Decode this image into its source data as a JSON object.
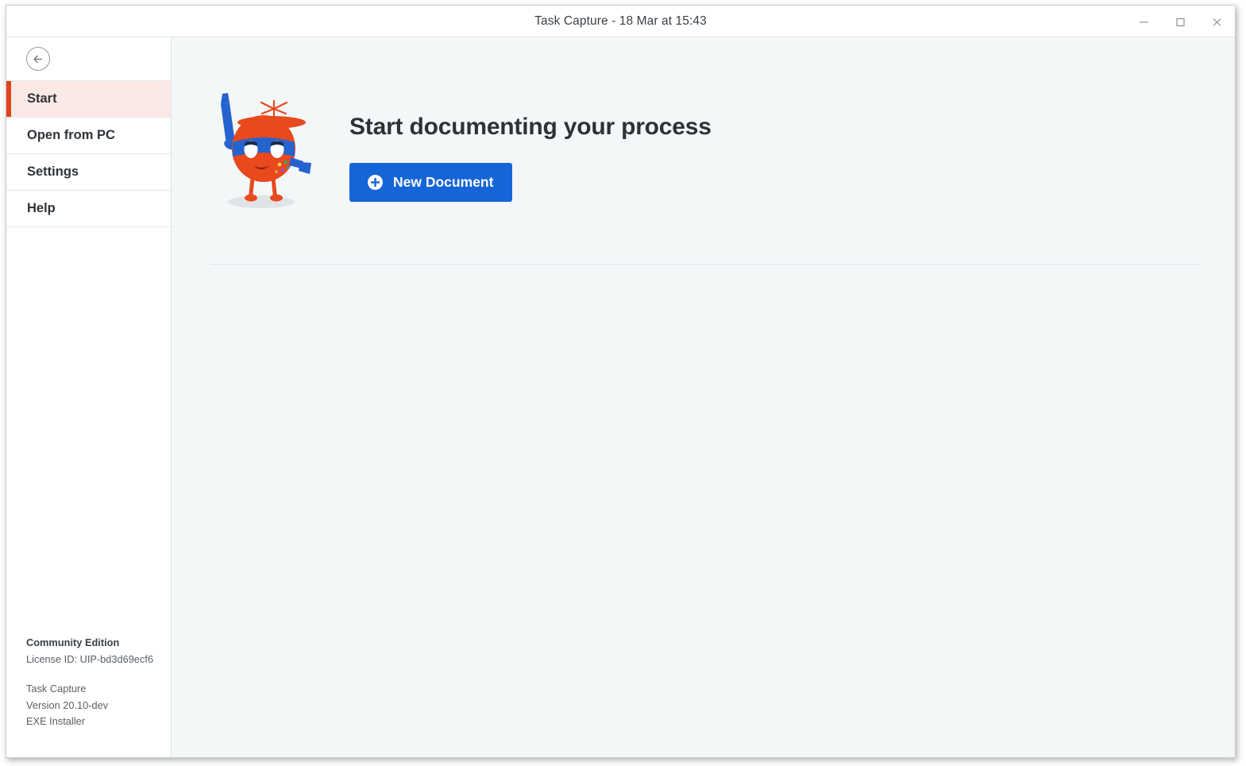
{
  "window": {
    "title": "Task Capture - 18 Mar at 15:43",
    "controls": {
      "minimize": "minimize-button",
      "maximize": "maximize-button",
      "close": "close-button"
    }
  },
  "sidebar": {
    "back_button": "back-arrow",
    "items": [
      {
        "label": "Start",
        "active": true
      },
      {
        "label": "Open from PC",
        "active": false
      },
      {
        "label": "Settings",
        "active": false
      },
      {
        "label": "Help",
        "active": false
      }
    ],
    "footer": {
      "edition": "Community Edition",
      "license": "License ID: UIP-bd3d69ecf6",
      "product": "Task Capture",
      "version": "Version 20.10-dev",
      "installer": "EXE Installer"
    }
  },
  "main": {
    "heading": "Start documenting your process",
    "primary_button": {
      "label": "New Document",
      "icon": "plus-circle-icon"
    },
    "illustration": "robot-mascot"
  },
  "colors": {
    "accent_red": "#e0451b",
    "active_item_bg": "#fbe9e5",
    "primary_blue": "#1565d8",
    "content_bg": "#f4f7f8",
    "mascot_orange": "#e8491d",
    "mascot_blue": "#2563cf"
  }
}
